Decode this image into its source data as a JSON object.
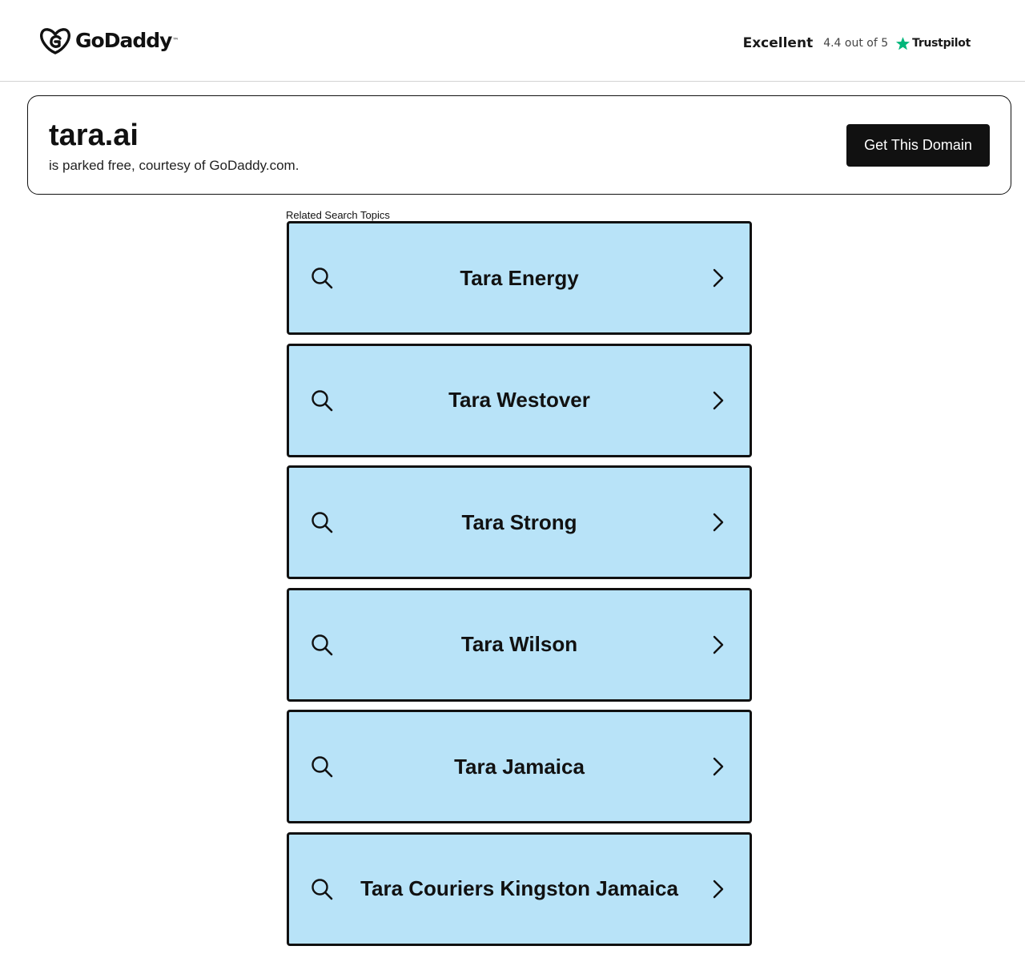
{
  "header": {
    "logo_text": "GoDaddy",
    "rating_word": "Excellent",
    "rating_score": "4.4 out of 5",
    "trustpilot_label": "Trustpilot",
    "trustpilot_star_color": "#00b67a"
  },
  "domain": {
    "name": "tara.ai",
    "subtitle": "is parked free, courtesy of GoDaddy.com.",
    "cta_label": "Get This Domain"
  },
  "related": {
    "label": "Related Search Topics",
    "background_color": "#b8e3f8",
    "topics": [
      "Tara Energy",
      "Tara Westover",
      "Tara Strong",
      "Tara Wilson",
      "Tara Jamaica",
      "Tara Couriers Kingston Jamaica"
    ]
  }
}
